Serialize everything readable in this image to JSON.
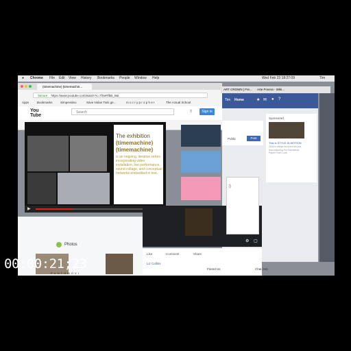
{
  "menubar": {
    "apple": "",
    "app": "Chrome",
    "items": [
      "File",
      "Edit",
      "View",
      "History",
      "Bookmarks",
      "People",
      "Window",
      "Help"
    ],
    "clock": "Wed Feb 23 18:27:09",
    "user": "Tim"
  },
  "youtube_window": {
    "tab_title": "(timemachine) (timemachin...",
    "url_secure": "Secure",
    "url": "https://www.youtube.com/watch?v=7fXeRfbB_tI&t",
    "bookmarks": [
      "Apps",
      "Bookmarks",
      "Simpevideo",
      "Save Nolan Twis ge...",
      "m o c r y p r o p h e t",
      "The Actual School"
    ],
    "logo_text": "You Tube",
    "search_placeholder": "Search",
    "signin_label": "Sign in",
    "slide_title": "The exhibition",
    "slide_highlight_1": "(timemachine)",
    "slide_highlight_2": "(timemachine)",
    "slide_body": "is an ongoing, iterative series incorporating video installation, live performance, sound collage, and conceptual networks embedded in text."
  },
  "facebook_window": {
    "tab_title": "ART CROWN | Fre... ",
    "tab_title_2": "Arte Povera - Wiki...",
    "user_name": "Tim",
    "nav_label": "Home",
    "sponsored_label": "Sponsored",
    "ad_text": "This is STYLE IN MOTION",
    "ad_sub": "Click to follow for more art you love featuring Pro Barnstead Paper Point Look",
    "public_label": "Public",
    "post_button": "Post"
  },
  "lower_window": {
    "photos_label": "Photos",
    "post_actions": [
      "Like",
      "Comment",
      "Share"
    ],
    "reaction": "Liz Collins",
    "chat_label": "Chat (56)",
    "friend_label": "Friend Us",
    "tag_text": "P U N T O M O V I"
  },
  "timecode": "00:00:21;23"
}
